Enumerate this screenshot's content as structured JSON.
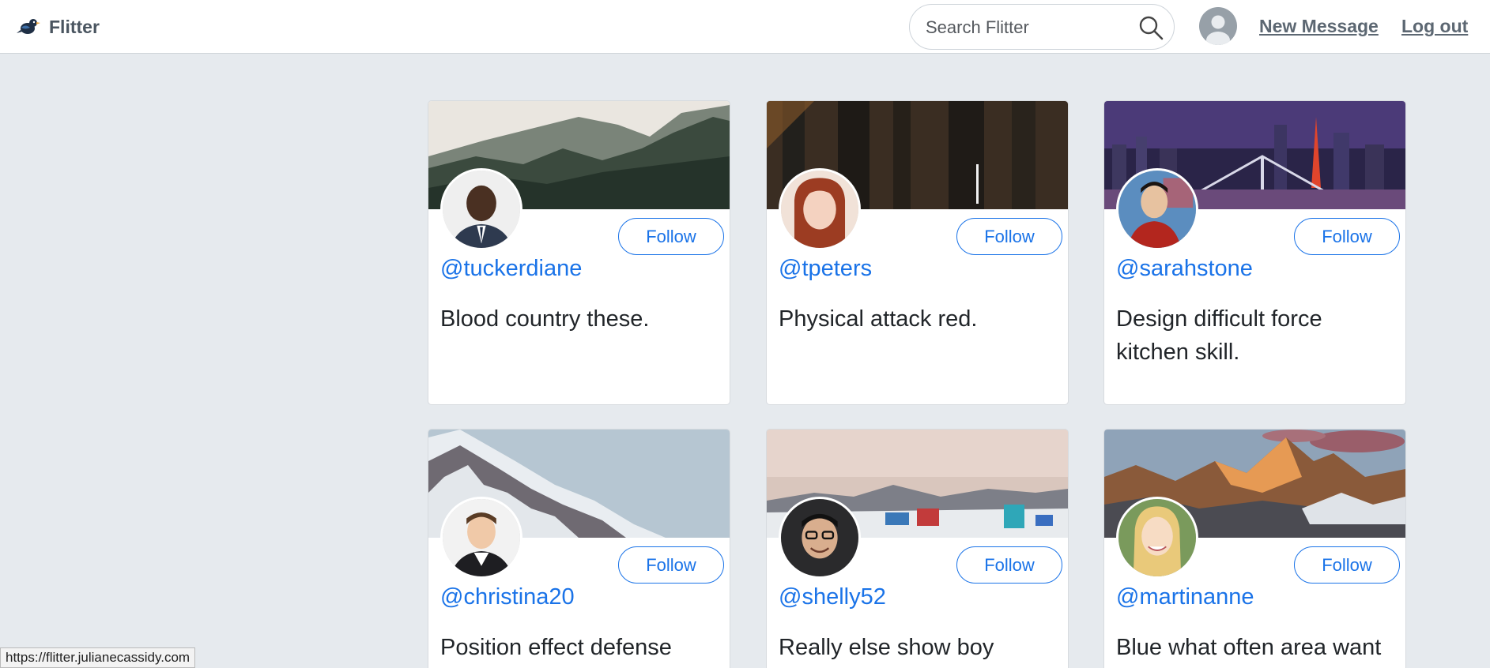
{
  "app": {
    "name": "Flitter"
  },
  "search": {
    "placeholder": "Search Flitter"
  },
  "nav": {
    "new_message": "New Message",
    "logout": "Log out"
  },
  "colors": {
    "accent": "#1a73e8",
    "background": "#e6eaee",
    "navbar": "#ffffff"
  },
  "icons": {
    "logo": "bird-icon",
    "search": "search-icon",
    "avatar": "user-avatar-icon"
  },
  "cards": [
    {
      "handle": "@tuckerdiane",
      "text": "Blood country these.",
      "follow": "Follow"
    },
    {
      "handle": "@tpeters",
      "text": "Physical attack red.",
      "follow": "Follow"
    },
    {
      "handle": "@sarahstone",
      "text": "Design difficult force kitchen skill.",
      "follow": "Follow"
    },
    {
      "handle": "@christina20",
      "text": "Position effect defense",
      "follow": "Follow"
    },
    {
      "handle": "@shelly52",
      "text": "Really else show boy accept",
      "follow": "Follow"
    },
    {
      "handle": "@martinanne",
      "text": "Blue what often area want",
      "follow": "Follow"
    }
  ],
  "status_url": "https://flitter.julianecassidy.com"
}
